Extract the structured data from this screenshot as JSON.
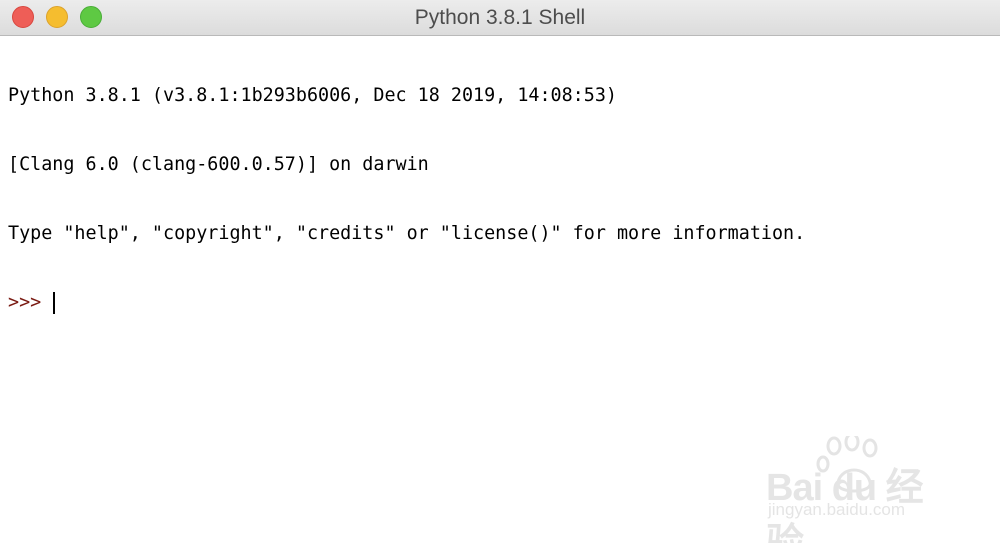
{
  "window": {
    "title": "Python 3.8.1 Shell"
  },
  "console": {
    "lines": [
      "Python 3.8.1 (v3.8.1:1b293b6006, Dec 18 2019, 14:08:53)",
      "[Clang 6.0 (clang-600.0.57)] on darwin",
      "Type \"help\", \"copyright\", \"credits\" or \"license()\" for more information."
    ],
    "prompt": ">>>"
  },
  "watermark": {
    "brand": "Bai du 经验",
    "url": "jingyan.baidu.com"
  },
  "colors": {
    "close": "#ee5e57",
    "minimize": "#f5bd2f",
    "maximize": "#5ec943",
    "prompt": "#7a1a12"
  }
}
